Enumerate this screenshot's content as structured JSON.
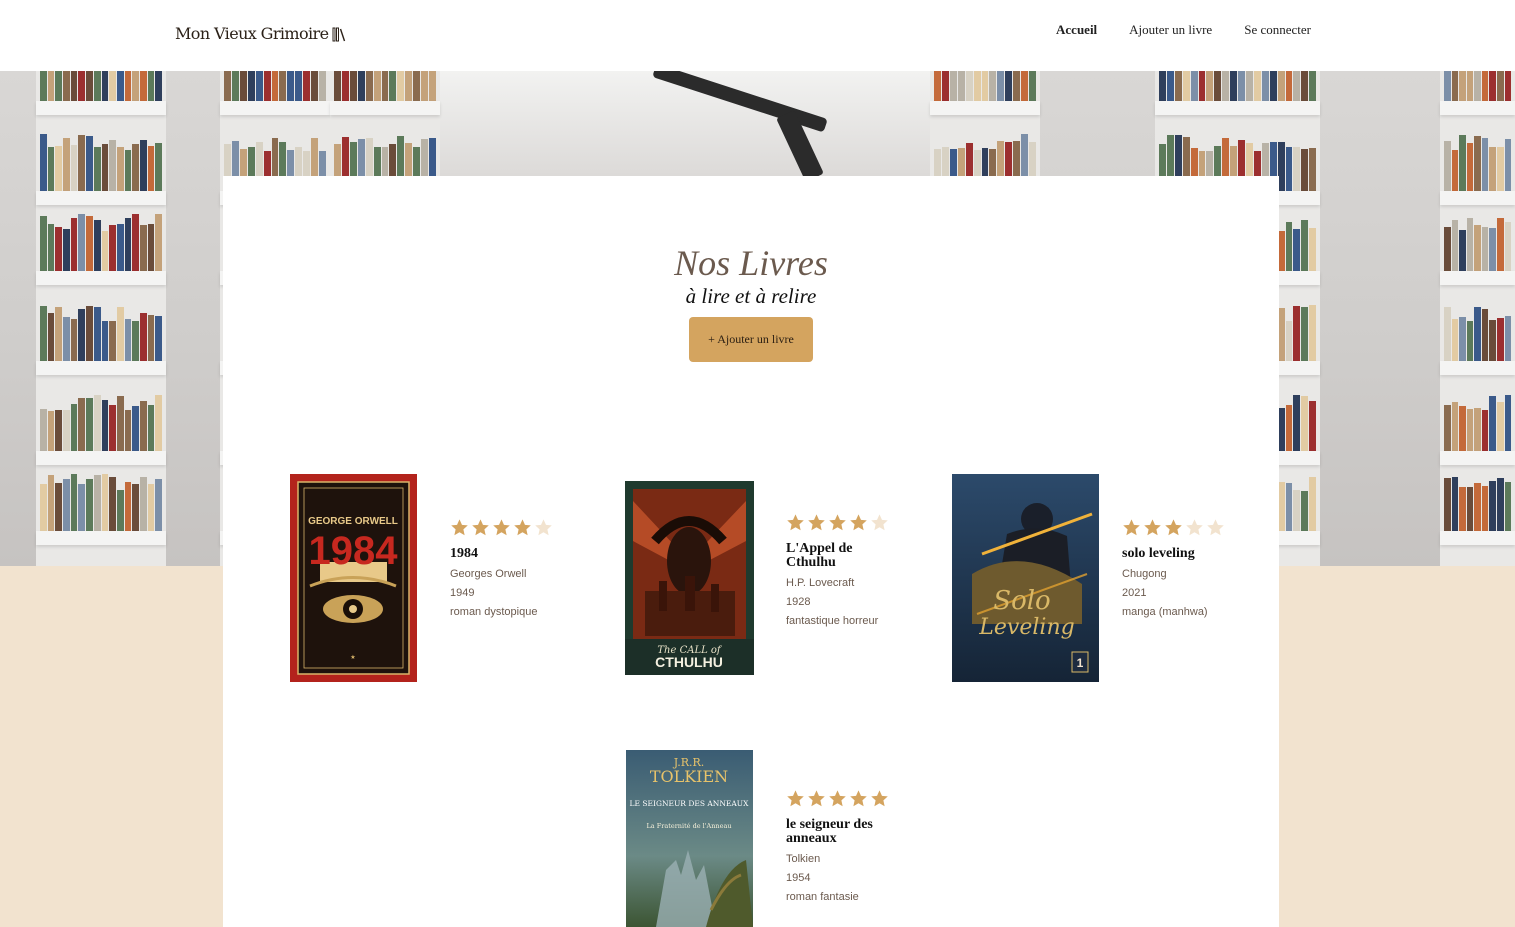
{
  "header": {
    "logo": "Mon Vieux Grimoire",
    "nav": [
      "Accueil",
      "Ajouter un livre",
      "Se connecter"
    ],
    "active": "Accueil"
  },
  "main": {
    "title": "Nos Livres",
    "subtitle": "à lire et à relire",
    "add_button": "+ Ajouter un livre"
  },
  "colors": {
    "accent": "#d4a45f",
    "star": "#d4a45f",
    "star_empty": "#f2e3cf",
    "beige": "#f2e3cf"
  },
  "books": [
    {
      "title": "1984",
      "author": "Georges Orwell",
      "year": "1949",
      "genre": "roman dystopique",
      "rating": 4,
      "cover": {
        "line1": "GEORGE ORWELL",
        "line2": "1984"
      }
    },
    {
      "title": "L'Appel de Cthulhu",
      "author": "H.P. Lovecraft",
      "year": "1928",
      "genre": "fantastique horreur",
      "rating": 4,
      "cover": {
        "line1": "The CALL of",
        "line2": "CTHULHU"
      }
    },
    {
      "title": "solo leveling",
      "author": "Chugong",
      "year": "2021",
      "genre": "manga (manhwa)",
      "rating": 3,
      "cover": {
        "line1": "Solo",
        "line2": "Leveling",
        "badge": "1"
      }
    },
    {
      "title": "le seigneur des anneaux",
      "author": "Tolkien",
      "year": "1954",
      "genre": "roman fantasie",
      "rating": 5,
      "cover": {
        "line1": "J.R.R.",
        "line2": "TOLKIEN",
        "line3": "LE SEIGNEUR DES ANNEAUX",
        "line4": "La Fraternité de l'Anneau"
      }
    }
  ]
}
